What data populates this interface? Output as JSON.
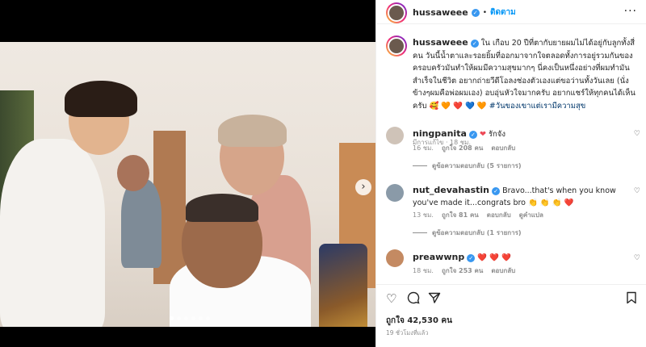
{
  "header": {
    "username": "hussaweee",
    "separator": "•",
    "follow_label": "ติดตาม",
    "more": "···"
  },
  "caption": {
    "username": "hussaweee",
    "text": "ใน เกือบ 20 ปีที่ตากับยายผมไม่ได้อยู่กับลูกทั้งสี่คน วันนี้น้ำตาและรอยยิ้มที่ออกมาจากใจตลอดทั้งการอยู่รวมกันของครอบครัวมันทำให้ผมมีความสุขมากๆ นี่คงเป็นหนึ่งอย่างที่ผมทำมันสำเร็จในชีวิต อยากถ่ายวีดีโอลงช่องตัวเองแต่ขอว่านทั้งวันเลย (นั่งข้างๆผมคือพ่อผมเอง) อบอุ่นหัวใจมากครับ อยากแชร์ให้ทุกคนได้เห็นครับ 🥰 🧡 ❤️ 💙",
    "hashtag": "🧡 #วันของเขาแต่เรามีความสุข",
    "meta": "มีการแก้ไข · 18 ชม."
  },
  "comments": [
    {
      "username": "ningpanita",
      "text": "รักจัง",
      "time": "16 ชม.",
      "likes": "ถูกใจ 208 คน",
      "reply": "ตอบกลับ",
      "extra": "",
      "replies_label": "ดูข้อความตอบกลับ (5 รายการ)"
    },
    {
      "username": "nut_devahastin",
      "text": "Bravo...that's when you know you've made it...congrats bro 👏 👏 👏 ❤️",
      "time": "13 ชม.",
      "likes": "ถูกใจ 81 คน",
      "reply": "ตอบกลับ",
      "extra": "ดูคำแปล",
      "replies_label": "ดูข้อความตอบกลับ (1 รายการ)"
    },
    {
      "username": "preawwnp",
      "text": "❤️ ❤️ ❤️",
      "time": "18 ชม.",
      "likes": "ถูกใจ 253 คน",
      "reply": "ตอบกลับ",
      "extra": "",
      "replies_label": ""
    }
  ],
  "actions": {
    "likes": "ถูกใจ 42,530 คน",
    "time": "19 ชั่วโมงที่แล้ว"
  },
  "carousel": {
    "next_arrow": "›"
  },
  "colors": {
    "accent": "#0095f6",
    "verified": "#3897f0",
    "heart": "#ed4956"
  }
}
